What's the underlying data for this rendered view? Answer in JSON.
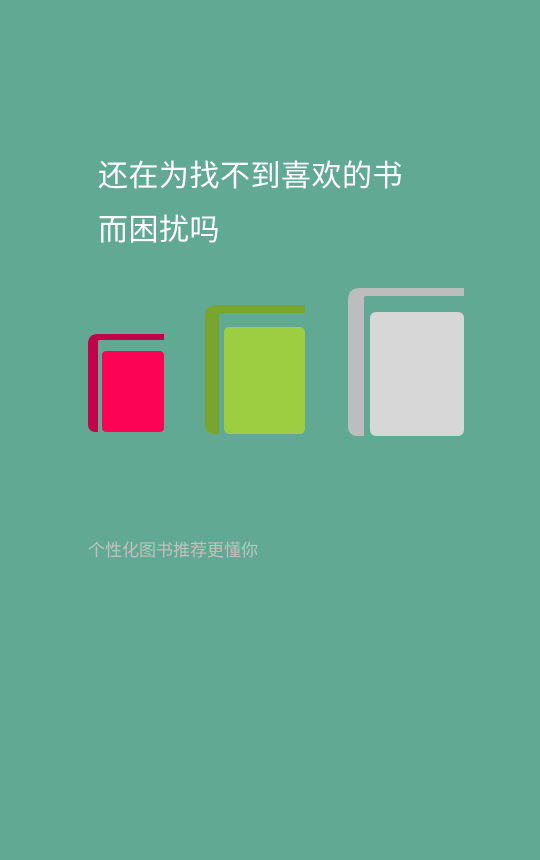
{
  "splash": {
    "headline_line1": "还在为找不到喜欢的书",
    "headline_line2": "而困扰吗",
    "tagline": "个性化图书推荐更懂你"
  },
  "colors": {
    "background": "#62a994",
    "headline_text": "#ffffff",
    "tagline_text": "#c3c0bd",
    "book_small_cover": "#fd0356",
    "book_small_spine": "#bf0547",
    "book_medium_cover": "#9dcd40",
    "book_medium_spine": "#78a52e",
    "book_large_cover": "#d8d7d8",
    "book_large_spine": "#bcbdbd"
  },
  "icons": {
    "book_small": "book-icon",
    "book_medium": "book-icon",
    "book_large": "book-icon"
  }
}
